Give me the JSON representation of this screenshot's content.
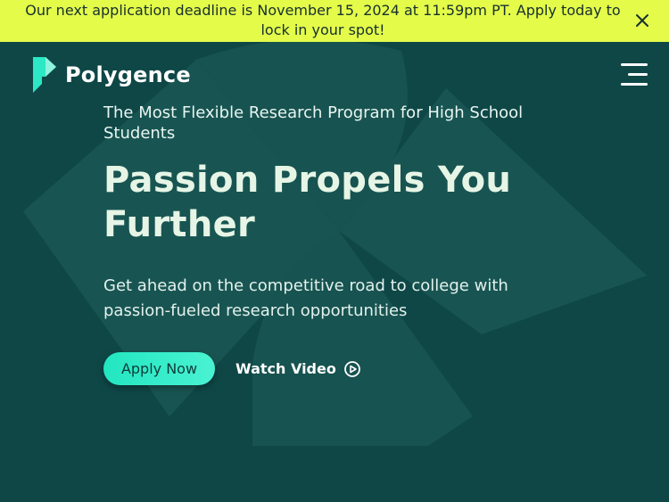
{
  "banner": {
    "text": "Our next application deadline is November 15, 2024 at 11:59pm PT. Apply today to lock in your spot!",
    "close_icon": "close-icon"
  },
  "nav": {
    "logo_text": "Polygence",
    "logo_icon": "polygence-logo-icon",
    "menu_icon": "hamburger-menu-icon"
  },
  "hero": {
    "eyebrow": "The Most Flexible Research Program for High School Students",
    "headline": "Passion Propels You Further",
    "subtext": "Get ahead on the competitive road to college with passion-fueled research opportunities",
    "apply_label": "Apply Now",
    "watch_label": "Watch Video",
    "play_icon": "play-circle-icon"
  },
  "colors": {
    "banner_bg": "#e4fb4a",
    "hero_bg": "#0f4747",
    "accent": "#2ce8c4",
    "shape": "#1a5a55"
  }
}
